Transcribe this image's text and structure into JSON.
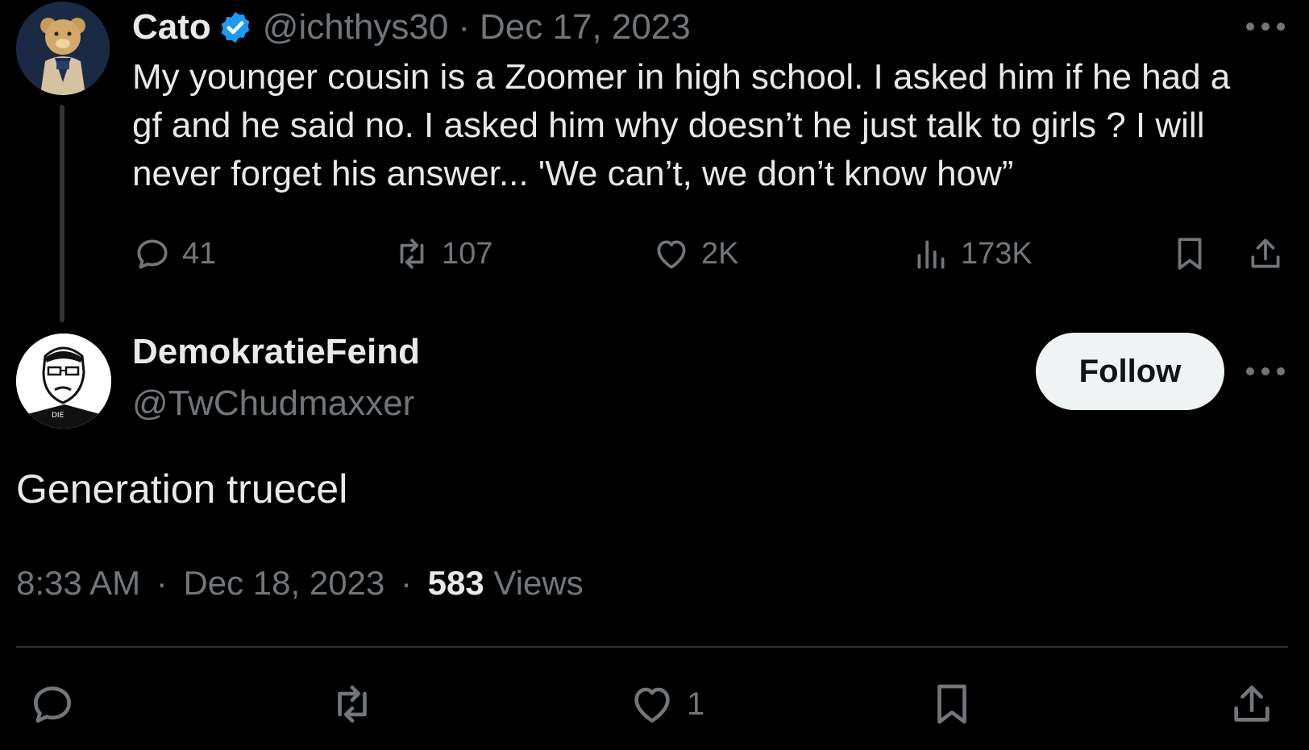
{
  "parent_tweet": {
    "name": "Cato",
    "handle": "@ichthys30",
    "separator": "·",
    "date": "Dec 17, 2023",
    "text": "My younger cousin is a Zoomer in high school. I asked him if he had a gf and he said no. I asked him why doesn’t he just talk to girls ? I will never forget his answer... 'We can’t, we don’t know how”",
    "avatar_icon": "teddy-bear-avatar",
    "verified_icon": "verified-badge-icon",
    "stats": {
      "replies": "41",
      "reposts": "107",
      "likes": "2K",
      "views": "173K"
    }
  },
  "reply_tweet": {
    "name": "DemokratieFeind",
    "handle": "@TwChudmaxxer",
    "avatar_icon": "sketch-avatar",
    "follow_label": "Follow",
    "text": "Generation truecel",
    "time": "8:33 AM",
    "separator": "·",
    "date": "Dec 18, 2023",
    "views_count": "583",
    "views_label": "Views",
    "like_count": "1"
  },
  "colors": {
    "background": "#000000",
    "text": "#e7e9ea",
    "muted": "#71767b",
    "verified": "#1d9bf0",
    "divider": "#2f3336",
    "follow_bg": "#eff3f4"
  }
}
